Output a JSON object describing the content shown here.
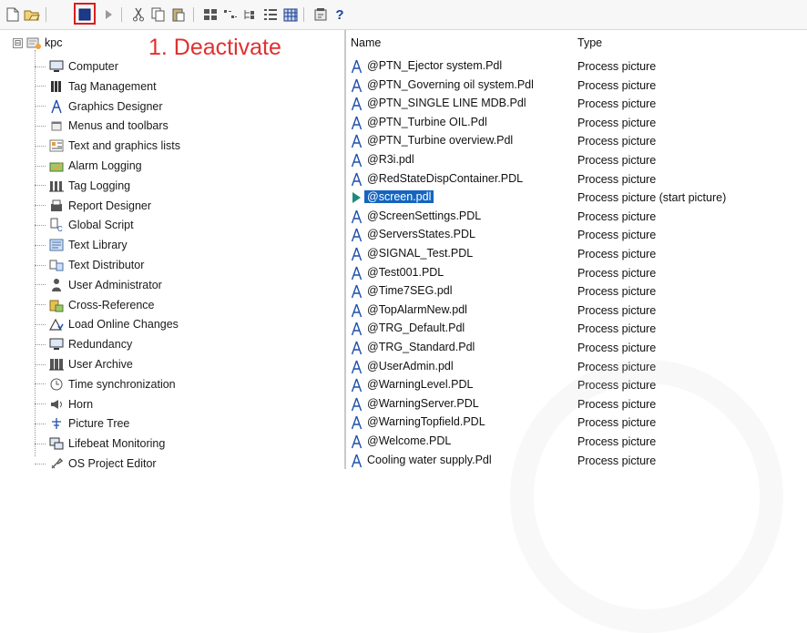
{
  "toolbar": {
    "icons": [
      "new-file-icon",
      "open-icon",
      "deactivate-stop-icon",
      "activate-run-icon",
      "cut-icon",
      "copy-icon",
      "paste-icon",
      "grid-small-icon",
      "grid-list-icon",
      "tree-view-icon",
      "tree-detail-icon",
      "table-view-icon",
      "properties-icon",
      "help-icon"
    ],
    "help_label": "?"
  },
  "annotation": {
    "text": "1. Deactivate",
    "color": "#e03030"
  },
  "tree": {
    "root_label": "kpc",
    "collapse_glyph": "⊟",
    "items": [
      {
        "label": "Computer",
        "icon": "computer-icon"
      },
      {
        "label": "Tag Management",
        "icon": "tag-management-icon"
      },
      {
        "label": "Graphics Designer",
        "icon": "graphics-designer-icon"
      },
      {
        "label": "Menus and toolbars",
        "icon": "menus-toolbars-icon"
      },
      {
        "label": "Text and graphics lists",
        "icon": "text-graphics-lists-icon"
      },
      {
        "label": "Alarm Logging",
        "icon": "alarm-logging-icon"
      },
      {
        "label": "Tag Logging",
        "icon": "tag-logging-icon"
      },
      {
        "label": "Report Designer",
        "icon": "report-designer-icon"
      },
      {
        "label": "Global Script",
        "icon": "global-script-icon"
      },
      {
        "label": "Text Library",
        "icon": "text-library-icon"
      },
      {
        "label": "Text Distributor",
        "icon": "text-distributor-icon"
      },
      {
        "label": "User Administrator",
        "icon": "user-administrator-icon"
      },
      {
        "label": "Cross-Reference",
        "icon": "cross-reference-icon"
      },
      {
        "label": "Load Online Changes",
        "icon": "load-online-changes-icon"
      },
      {
        "label": "Redundancy",
        "icon": "redundancy-icon"
      },
      {
        "label": "User Archive",
        "icon": "user-archive-icon"
      },
      {
        "label": "Time synchronization",
        "icon": "time-sync-icon"
      },
      {
        "label": "Horn",
        "icon": "horn-icon"
      },
      {
        "label": "Picture Tree",
        "icon": "picture-tree-icon"
      },
      {
        "label": "Lifebeat Monitoring",
        "icon": "lifebeat-monitoring-icon"
      },
      {
        "label": "OS Project Editor",
        "icon": "os-project-editor-icon"
      }
    ]
  },
  "list": {
    "headers": {
      "name": "Name",
      "type": "Type"
    },
    "rows": [
      {
        "name": "@PTN_Ejector system.Pdl",
        "type": "Process picture"
      },
      {
        "name": "@PTN_Governing oil system.Pdl",
        "type": "Process picture"
      },
      {
        "name": "@PTN_SINGLE LINE MDB.Pdl",
        "type": "Process picture"
      },
      {
        "name": "@PTN_Turbine OIL.Pdl",
        "type": "Process picture"
      },
      {
        "name": "@PTN_Turbine overview.Pdl",
        "type": "Process picture"
      },
      {
        "name": "@R3i.pdl",
        "type": "Process picture"
      },
      {
        "name": "@RedStateDispContainer.PDL",
        "type": "Process picture"
      },
      {
        "name": "@screen.pdl",
        "type": "Process picture (start picture)",
        "selected": true
      },
      {
        "name": "@ScreenSettings.PDL",
        "type": "Process picture"
      },
      {
        "name": "@ServersStates.PDL",
        "type": "Process picture"
      },
      {
        "name": "@SIGNAL_Test.PDL",
        "type": "Process picture"
      },
      {
        "name": "@Test001.PDL",
        "type": "Process picture"
      },
      {
        "name": "@Time7SEG.pdl",
        "type": "Process picture"
      },
      {
        "name": "@TopAlarmNew.pdl",
        "type": "Process picture"
      },
      {
        "name": "@TRG_Default.Pdl",
        "type": "Process picture"
      },
      {
        "name": "@TRG_Standard.Pdl",
        "type": "Process picture"
      },
      {
        "name": "@UserAdmin.pdl",
        "type": "Process picture"
      },
      {
        "name": "@WarningLevel.PDL",
        "type": "Process picture"
      },
      {
        "name": "@WarningServer.PDL",
        "type": "Process picture"
      },
      {
        "name": "@WarningTopfield.PDL",
        "type": "Process picture"
      },
      {
        "name": "@Welcome.PDL",
        "type": "Process picture"
      },
      {
        "name": "Cooling water supply.Pdl",
        "type": "Process picture"
      }
    ]
  },
  "colors": {
    "accent": "#1565c0",
    "highlight": "#d62020",
    "annotation": "#e03030"
  }
}
